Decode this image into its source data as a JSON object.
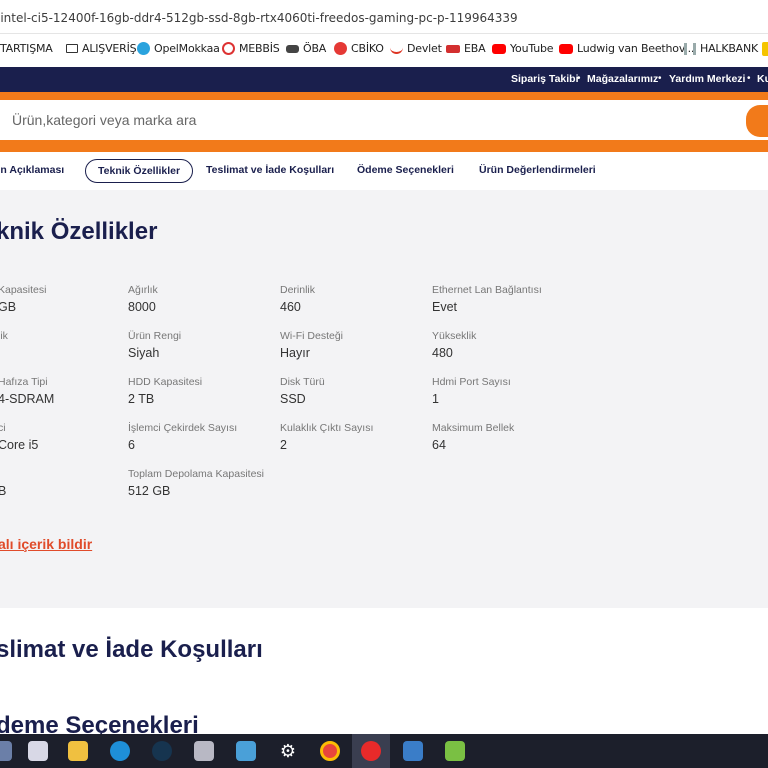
{
  "browser": {
    "url": "-intel-ci5-12400f-16gb-ddr4-512gb-ssd-8gb-rtx4060ti-freedos-gaming-pc-p-119964339",
    "bookmarks": [
      {
        "label": "TARTIŞMA",
        "icon": "bookmark-icon"
      },
      {
        "label": "ALIŞVERİŞ",
        "icon": "folder-icon"
      },
      {
        "label": "OpelMokkaa",
        "icon": "telegram-icon"
      },
      {
        "label": "MEBBİS",
        "icon": "mebbis-icon"
      },
      {
        "label": "ÖBA",
        "icon": "oba-icon"
      },
      {
        "label": "CBİKO",
        "icon": "cbiko-icon"
      },
      {
        "label": "Devlet",
        "icon": "edevlet-icon"
      },
      {
        "label": "EBA",
        "icon": "eba-icon"
      },
      {
        "label": "YouTube",
        "icon": "youtube-icon"
      },
      {
        "label": "Ludwig van Beethov...",
        "icon": "youtube-icon"
      },
      {
        "label": "HALKBANK",
        "icon": "halkbank-icon"
      }
    ]
  },
  "topnav": {
    "links": [
      "Sipariş Takibi",
      "Mağazalarımız",
      "Yardım Merkezi",
      "Ku"
    ]
  },
  "search": {
    "placeholder": "Ürün,kategori veya marka ara"
  },
  "tabs": [
    {
      "label": "ün Açıklaması",
      "active": false
    },
    {
      "label": "Teknik Özellikler",
      "active": true
    },
    {
      "label": "Teslimat ve İade Koşulları",
      "active": false
    },
    {
      "label": "Ödeme Seçenekleri",
      "active": false
    },
    {
      "label": "Ürün Değerlendirmeleri",
      "active": false
    }
  ],
  "specs": {
    "title": "knik Özellikler",
    "columns": [
      [
        {
          "label": "Kapasitesi",
          "value": "GB"
        },
        {
          "label": "lik",
          "value": ""
        },
        {
          "label": "Hafıza Tipi",
          "value": "4-SDRAM"
        },
        {
          "label": "ci",
          "value": "Core i5"
        },
        {
          "label": "",
          "value": "B"
        }
      ],
      [
        {
          "label": "Ağırlık",
          "value": "8000"
        },
        {
          "label": "Ürün Rengi",
          "value": "Siyah"
        },
        {
          "label": "HDD Kapasitesi",
          "value": "2 TB"
        },
        {
          "label": "İşlemci Çekirdek Sayısı",
          "value": "6"
        },
        {
          "label": "Toplam Depolama Kapasitesi",
          "value": "512 GB"
        }
      ],
      [
        {
          "label": "Derinlik",
          "value": "460"
        },
        {
          "label": "Wi-Fi Desteği",
          "value": "Hayır"
        },
        {
          "label": "Disk Türü",
          "value": "SSD"
        },
        {
          "label": "Kulaklık Çıktı Sayısı",
          "value": "2"
        }
      ],
      [
        {
          "label": "Ethernet Lan Bağlantısı",
          "value": "Evet"
        },
        {
          "label": "Yükseklik",
          "value": "480"
        },
        {
          "label": "Hdmi Port Sayısı",
          "value": "1"
        },
        {
          "label": "Maksimum Bellek",
          "value": "64"
        }
      ]
    ],
    "report_link": "alı içerik bildir"
  },
  "sections": {
    "delivery_title": "slimat ve İade Koşulları",
    "payment_title": "deme Seçenekleri"
  },
  "taskbar": {
    "icons": [
      "file-icon",
      "paint-icon",
      "explorer-icon",
      "edge-icon",
      "steam-icon",
      "network-icon",
      "contacts-icon",
      "settings-icon",
      "chrome-icon",
      "opera-icon",
      "computer-icon",
      "bluestacks-icon"
    ]
  },
  "colors": {
    "brand_orange": "#f27a1a",
    "navy": "#1a1f4d",
    "link_red": "#e04b2a"
  }
}
